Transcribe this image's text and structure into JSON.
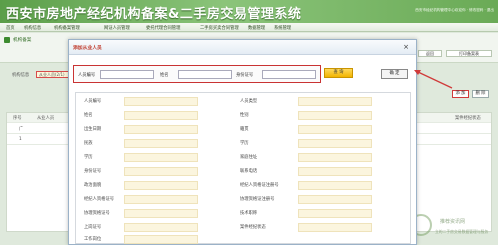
{
  "banner": {
    "title": "西安市房地产经纪机构备案&二手房交易管理系统",
    "info": "西安市经纪机构管理中心欢迎你 · 修改密码 · 退出"
  },
  "topnav": {
    "items": [
      "首页",
      "机构信息",
      "机构备案管理",
      "网证人员管理",
      "委托代理合同管理",
      "二手房买卖合同管理",
      "数据管理",
      "系统管理"
    ]
  },
  "subbar": {
    "title": "机构备案",
    "buttons": [
      "返回",
      "打印备案表"
    ]
  },
  "background": {
    "side_label": "机构信息",
    "side_tag": "从业人员(2/1)",
    "headers": [
      "序号",
      "从业人员",
      "案件经纪状态"
    ],
    "rows": [
      [
        "广"
      ],
      [
        "1"
      ]
    ],
    "add_label": "添 加",
    "del_label": "删 除"
  },
  "dialog": {
    "title": "添加从业人员",
    "close": "×",
    "search": {
      "id_label": "人员编号",
      "name_label": "姓名",
      "card_label": "身份证号",
      "query_label": "查 询",
      "confirm_label": "确 定"
    },
    "fields_left": [
      "人员编号",
      "姓名",
      "出生日期",
      "民族",
      "学历",
      "身份证号",
      "政治面貌",
      "经纪人资格证号",
      "协理资格证号",
      "上岗证号",
      "工作岗位"
    ],
    "fields_right": [
      "人员类型",
      "性别",
      "籍贯",
      "学历",
      "家庭住址",
      "联系电话",
      "经纪人资格证注册号",
      "协理资格证注册号",
      "技术职称",
      "案件经纪状态"
    ]
  },
  "watermark": {
    "line1": "推荐资讯网",
    "line2": "立的二手房交易数据管理与服务"
  }
}
